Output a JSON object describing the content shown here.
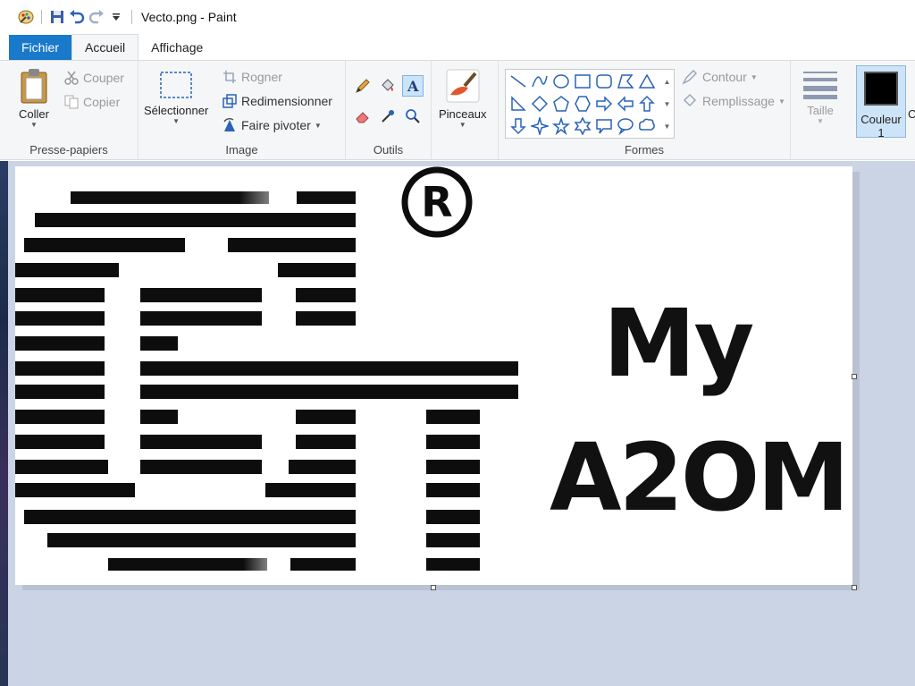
{
  "window": {
    "title": "Vecto.png - Paint"
  },
  "tabs": [
    {
      "label": "Fichier"
    },
    {
      "label": "Accueil"
    },
    {
      "label": "Affichage"
    }
  ],
  "ribbon": {
    "clipboard": {
      "group_label": "Presse-papiers",
      "paste": "Coller",
      "cut": "Couper",
      "copy": "Copier"
    },
    "image": {
      "group_label": "Image",
      "select": "Sélectionner",
      "crop": "Rogner",
      "resize": "Redimensionner",
      "rotate": "Faire pivoter"
    },
    "tools": {
      "group_label": "Outils"
    },
    "brushes": {
      "label": "Pinceaux"
    },
    "shapes": {
      "group_label": "Formes",
      "outline": "Contour",
      "fill": "Remplissage"
    },
    "size": {
      "label": "Taille"
    },
    "color1": {
      "label": "Couleur 1",
      "color": "#000000",
      "next_partial": "C"
    }
  },
  "canvas_image": {
    "registered_mark": "®",
    "text_line1": "My",
    "text_line2": "A2OM"
  },
  "colors": {
    "file_tab": "#1979ca",
    "workspace": "#cad4e4",
    "ribbon": "#f5f6f7"
  }
}
